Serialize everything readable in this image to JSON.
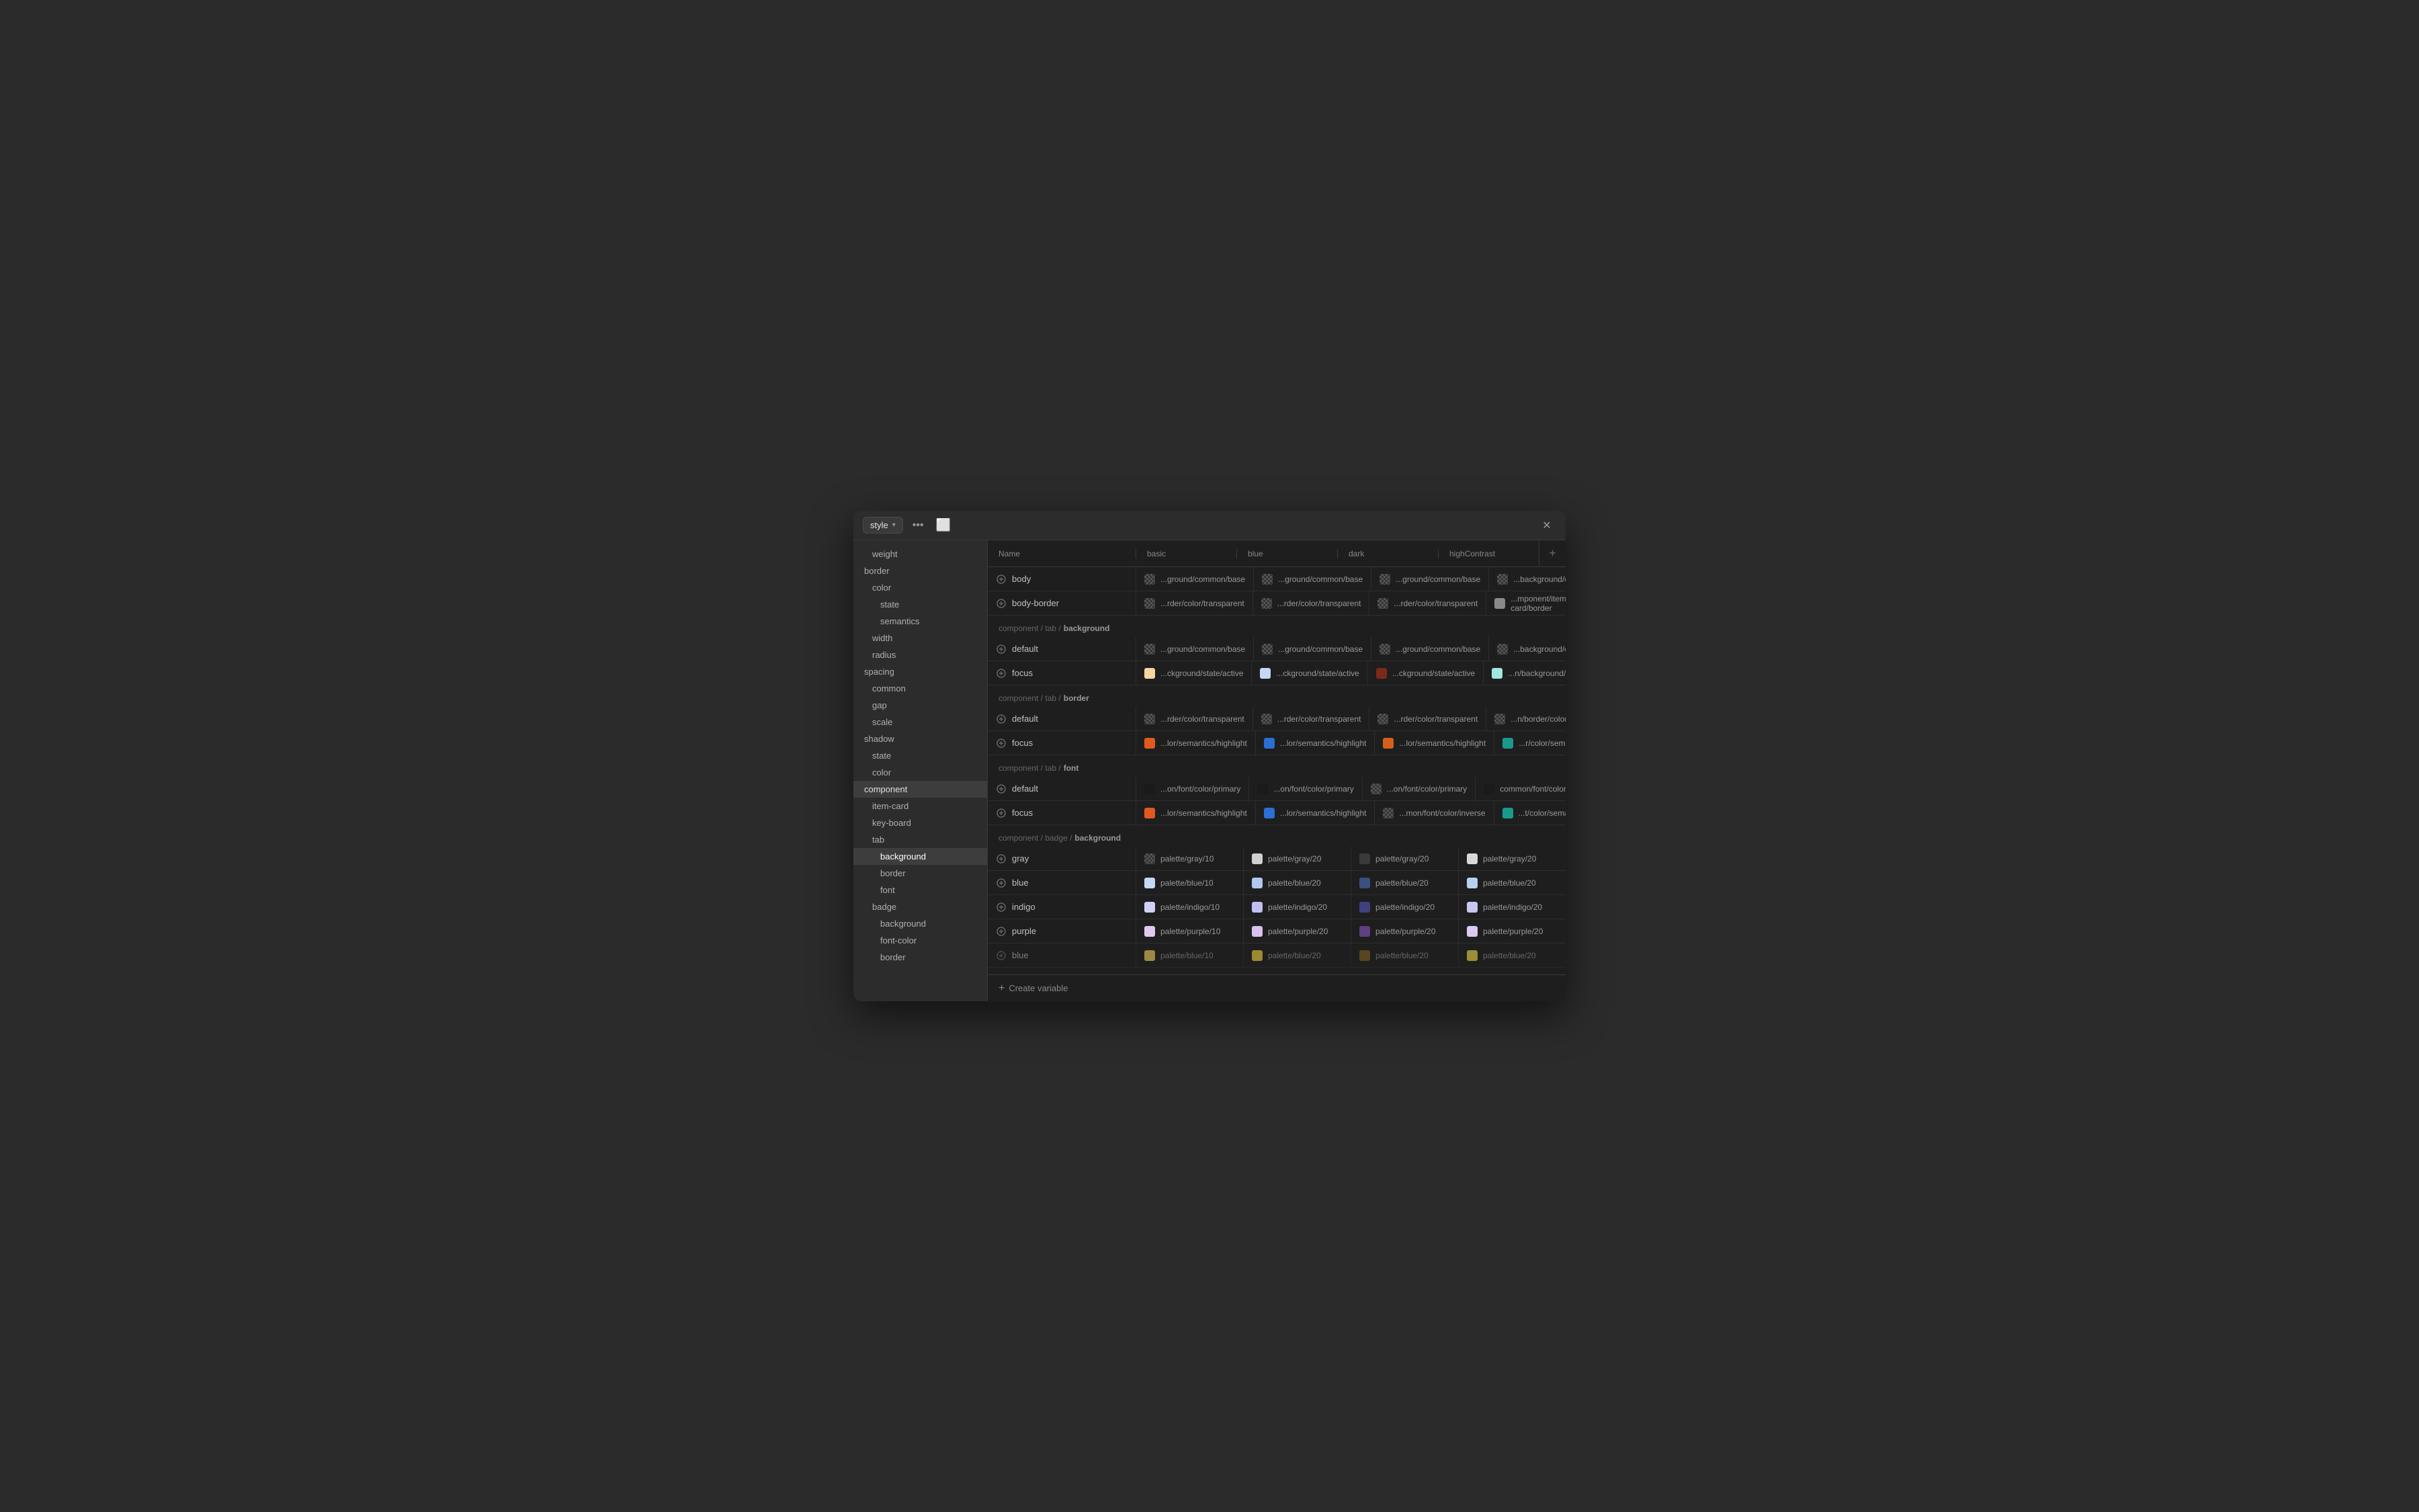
{
  "window": {
    "title": "style"
  },
  "sidebar": {
    "items": [
      {
        "id": "weight",
        "label": "weight",
        "indent": 1
      },
      {
        "id": "border",
        "label": "border",
        "indent": 0
      },
      {
        "id": "border-color",
        "label": "color",
        "indent": 1
      },
      {
        "id": "border-state",
        "label": "state",
        "indent": 2
      },
      {
        "id": "border-semantics",
        "label": "semantics",
        "indent": 2
      },
      {
        "id": "border-width",
        "label": "width",
        "indent": 1
      },
      {
        "id": "border-radius",
        "label": "radius",
        "indent": 1
      },
      {
        "id": "spacing",
        "label": "spacing",
        "indent": 0
      },
      {
        "id": "spacing-common",
        "label": "common",
        "indent": 1
      },
      {
        "id": "spacing-gap",
        "label": "gap",
        "indent": 1
      },
      {
        "id": "spacing-scale",
        "label": "scale",
        "indent": 1
      },
      {
        "id": "shadow",
        "label": "shadow",
        "indent": 0
      },
      {
        "id": "shadow-state",
        "label": "state",
        "indent": 1
      },
      {
        "id": "shadow-color",
        "label": "color",
        "indent": 1
      },
      {
        "id": "component",
        "label": "component",
        "indent": 0,
        "active": true
      },
      {
        "id": "item-card",
        "label": "item-card",
        "indent": 1
      },
      {
        "id": "key-board",
        "label": "key-board",
        "indent": 1
      },
      {
        "id": "tab",
        "label": "tab",
        "indent": 1
      },
      {
        "id": "tab-background",
        "label": "background",
        "indent": 2,
        "active": true
      },
      {
        "id": "tab-border",
        "label": "border",
        "indent": 2
      },
      {
        "id": "tab-font",
        "label": "font",
        "indent": 2
      },
      {
        "id": "badge",
        "label": "badge",
        "indent": 1
      },
      {
        "id": "badge-background",
        "label": "background",
        "indent": 2
      },
      {
        "id": "badge-font-color",
        "label": "font-color",
        "indent": 2
      },
      {
        "id": "badge-border",
        "label": "border",
        "indent": 2
      }
    ]
  },
  "table": {
    "columns": [
      {
        "id": "name",
        "label": "Name"
      },
      {
        "id": "basic",
        "label": "basic"
      },
      {
        "id": "blue",
        "label": "blue"
      },
      {
        "id": "dark",
        "label": "dark"
      },
      {
        "id": "highContrast",
        "label": "highContrast"
      }
    ],
    "sections": [
      {
        "id": "body-section",
        "header": null,
        "rows": [
          {
            "name": "body",
            "basic": {
              "text": "...ground/common/base",
              "swatch": "checker"
            },
            "blue": {
              "text": "...ground/common/base",
              "swatch": "checker"
            },
            "dark": {
              "text": "...ground/common/base",
              "swatch": "checker"
            },
            "highContrast": {
              "text": "...background/common/base",
              "swatch": "checker"
            }
          },
          {
            "name": "body-border",
            "basic": {
              "text": "...rder/color/transparent",
              "swatch": "checker"
            },
            "blue": {
              "text": "...rder/color/transparent",
              "swatch": "checker"
            },
            "dark": {
              "text": "...rder/color/transparent",
              "swatch": "checker"
            },
            "highContrast": {
              "text": "...mponent/item-card/border",
              "swatch": "#8a8a8a"
            }
          }
        ]
      },
      {
        "id": "tab-background-section",
        "header": "component / tab / background",
        "headerBold": "background",
        "rows": [
          {
            "name": "default",
            "basic": {
              "text": "...ground/common/base",
              "swatch": "checker"
            },
            "blue": {
              "text": "...ground/common/base",
              "swatch": "checker"
            },
            "dark": {
              "text": "...ground/common/base",
              "swatch": "checker"
            },
            "highContrast": {
              "text": "...background/common/base",
              "swatch": "checker"
            }
          },
          {
            "name": "focus",
            "basic": {
              "text": "...ckground/state/active",
              "swatch": "#f5d5a0"
            },
            "blue": {
              "text": "...ckground/state/active",
              "swatch": "#c5d8f5"
            },
            "dark": {
              "text": "...ckground/state/active",
              "swatch": "#7b2a1a"
            },
            "highContrast": {
              "text": "...n/background/state/active",
              "swatch": "#a0e8e0"
            }
          }
        ]
      },
      {
        "id": "tab-border-section",
        "header": "component / tab / border",
        "headerBold": "border",
        "rows": [
          {
            "name": "default",
            "basic": {
              "text": "...rder/color/transparent",
              "swatch": "checker"
            },
            "blue": {
              "text": "...rder/color/transparent",
              "swatch": "checker"
            },
            "dark": {
              "text": "...rder/color/transparent",
              "swatch": "checker"
            },
            "highContrast": {
              "text": "...n/border/color/transparent",
              "swatch": "checker"
            }
          },
          {
            "name": "focus",
            "basic": {
              "text": "...lor/semantics/highlight",
              "swatch": "#e05a20"
            },
            "blue": {
              "text": "...lor/semantics/highlight",
              "swatch": "#2b6fd4"
            },
            "dark": {
              "text": "...lor/semantics/highlight",
              "swatch": "#d4601a"
            },
            "highContrast": {
              "text": "...r/color/semantics/highlight",
              "swatch": "#1a9a8a"
            }
          }
        ]
      },
      {
        "id": "tab-font-section",
        "header": "component / tab / font",
        "headerBold": "font",
        "rows": [
          {
            "name": "default",
            "basic": {
              "text": "...on/font/color/primary",
              "swatch": "#1a1a1a"
            },
            "blue": {
              "text": "...on/font/color/primary",
              "swatch": "#1a1a1a"
            },
            "dark": {
              "text": "...on/font/color/primary",
              "swatch": "checker"
            },
            "highContrast": {
              "text": "common/font/color/primary",
              "swatch": "#1a1a1a"
            }
          },
          {
            "name": "focus",
            "basic": {
              "text": "...lor/semantics/highlight",
              "swatch": "#e05a20"
            },
            "blue": {
              "text": "...lor/semantics/highlight",
              "swatch": "#2b6fd4"
            },
            "dark": {
              "text": "...mon/font/color/inverse",
              "swatch": "checker"
            },
            "highContrast": {
              "text": "...t/color/semantics/highlight",
              "swatch": "#1a9a8a"
            }
          }
        ]
      },
      {
        "id": "badge-background-section",
        "header": "component / badge / background",
        "headerBold": "background",
        "rows": [
          {
            "name": "gray",
            "basic": {
              "text": "palette/gray/10",
              "swatch": "checker"
            },
            "blue": {
              "text": "palette/gray/20",
              "swatch": "#d0d0d0"
            },
            "dark": {
              "text": "palette/gray/20",
              "swatch": "#3a3a3a"
            },
            "highContrast": {
              "text": "palette/gray/20",
              "swatch": "#d8d8d8"
            }
          },
          {
            "name": "blue",
            "basic": {
              "text": "palette/blue/10",
              "swatch": "#c5d8f5"
            },
            "blue": {
              "text": "palette/blue/20",
              "swatch": "#b0c8f0"
            },
            "dark": {
              "text": "palette/blue/20",
              "swatch": "#3a5080"
            },
            "highContrast": {
              "text": "palette/blue/20",
              "swatch": "#b8d0f0"
            }
          },
          {
            "name": "indigo",
            "basic": {
              "text": "palette/indigo/10",
              "swatch": "#d0d0f5"
            },
            "blue": {
              "text": "palette/indigo/20",
              "swatch": "#c0c0f0"
            },
            "dark": {
              "text": "palette/indigo/20",
              "swatch": "#404080"
            },
            "highContrast": {
              "text": "palette/indigo/20",
              "swatch": "#c8c8f0"
            }
          },
          {
            "name": "purple",
            "basic": {
              "text": "palette/purple/10",
              "swatch": "#e0c8f0"
            },
            "blue": {
              "text": "palette/purple/20",
              "swatch": "#d8c0f0"
            },
            "dark": {
              "text": "palette/purple/20",
              "swatch": "#604080"
            },
            "highContrast": {
              "text": "palette/purple/20",
              "swatch": "#dcc8f0"
            }
          },
          {
            "name": "blue",
            "basic": {
              "text": "palette/blue/10",
              "swatch": "#f0d060"
            },
            "blue": {
              "text": "palette/blue/20",
              "swatch": "#f0d040"
            },
            "dark": {
              "text": "palette/blue/20",
              "swatch": "#806020"
            },
            "highContrast": {
              "text": "palette/blue/20",
              "swatch": "#f0d848"
            }
          }
        ]
      }
    ],
    "footer": {
      "createLabel": "Create variable"
    }
  },
  "icons": {
    "token": "⟳",
    "close": "✕",
    "plus": "+",
    "chevronDown": "▾",
    "sidebarToggle": "⬜"
  },
  "colors": {
    "accent": "#0066ff",
    "windowBg": "#1e1e1e",
    "sidebarBg": "#2c2c2c",
    "border": "#3a3a3a"
  }
}
